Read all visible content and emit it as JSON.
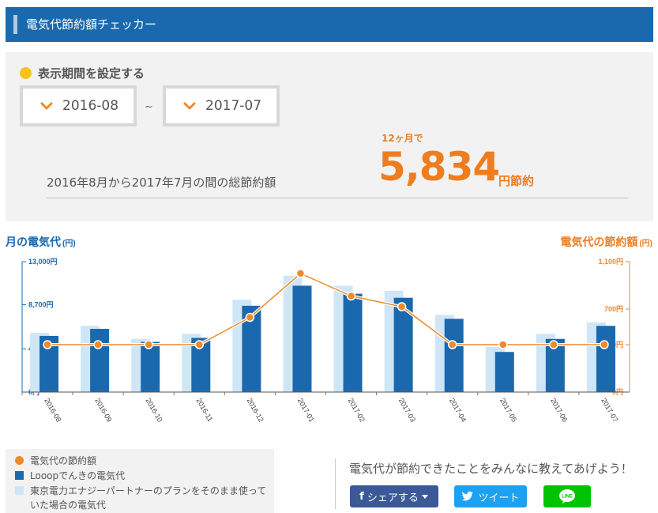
{
  "header": {
    "title": "電気代節約額チェッカー"
  },
  "period": {
    "label": "表示期間を設定する",
    "start": "2016-08",
    "end": "2017-07",
    "separator": "~"
  },
  "summary": {
    "total_label": "2016年8月から2017年7月の間の総節約額",
    "months_label": "12ヶ月で",
    "amount": "5,834",
    "amount_suffix": "円節約"
  },
  "chart_data": {
    "type": "bar",
    "left_title": "月の電気代",
    "left_unit": "(円)",
    "right_title": "電気代の節約額",
    "right_unit": "(円)",
    "categories": [
      "2016-08",
      "2016-09",
      "2016-10",
      "2016-11",
      "2016-12",
      "2017-01",
      "2017-02",
      "2017-03",
      "2017-04",
      "2017-05",
      "2017-06",
      "2017-07"
    ],
    "left_axis": {
      "min": 0,
      "max": 13000,
      "ticks": [
        0,
        4300,
        8700,
        13000
      ],
      "tick_labels": [
        "0円",
        "4,300円",
        "8,700円",
        "13,000円"
      ]
    },
    "right_axis": {
      "min": 0,
      "max": 1100,
      "ticks": [
        0,
        400,
        700,
        1100
      ],
      "tick_labels": [
        "0円",
        "400円",
        "700円",
        "1,100円"
      ]
    },
    "series": [
      {
        "name": "東京電力エナジーパートナーのプランをそのまま使っていた場合の電気代",
        "kind": "bar",
        "axis": "left",
        "color": "#cfe6f7",
        "values": [
          5900,
          6600,
          5300,
          5800,
          9200,
          11600,
          10600,
          10100,
          7700,
          4500,
          5800,
          6950
        ]
      },
      {
        "name": "Looopでんきの電気代",
        "kind": "bar",
        "axis": "left",
        "color": "#1a69ae",
        "values": [
          5600,
          6300,
          5000,
          5400,
          8600,
          10600,
          9800,
          9400,
          7300,
          4000,
          5300,
          6600
        ]
      },
      {
        "name": "電気代の節約額",
        "kind": "line",
        "axis": "right",
        "color": "#ee8a2a",
        "values": [
          400,
          400,
          400,
          400,
          630,
          1000,
          810,
          720,
          400,
          400,
          400,
          400
        ]
      }
    ]
  },
  "legend": {
    "items": [
      {
        "label": "電気代の節約額",
        "marker": "orange"
      },
      {
        "label": "Looopでんきの電気代",
        "marker": "blue"
      },
      {
        "label": "東京電力エナジーパートナーのプランをそのまま使っていた場合の電気代",
        "marker": "light"
      }
    ]
  },
  "share": {
    "text": "電気代が節約できたことをみんなに教えてあげよう！",
    "facebook_label": "シェアする",
    "twitter_label": "ツイート",
    "line_label": "LINE"
  },
  "colors": {
    "brand_blue": "#1a69ae",
    "accent_orange": "#ee7d1f",
    "light_blue": "#cfe6f7"
  }
}
